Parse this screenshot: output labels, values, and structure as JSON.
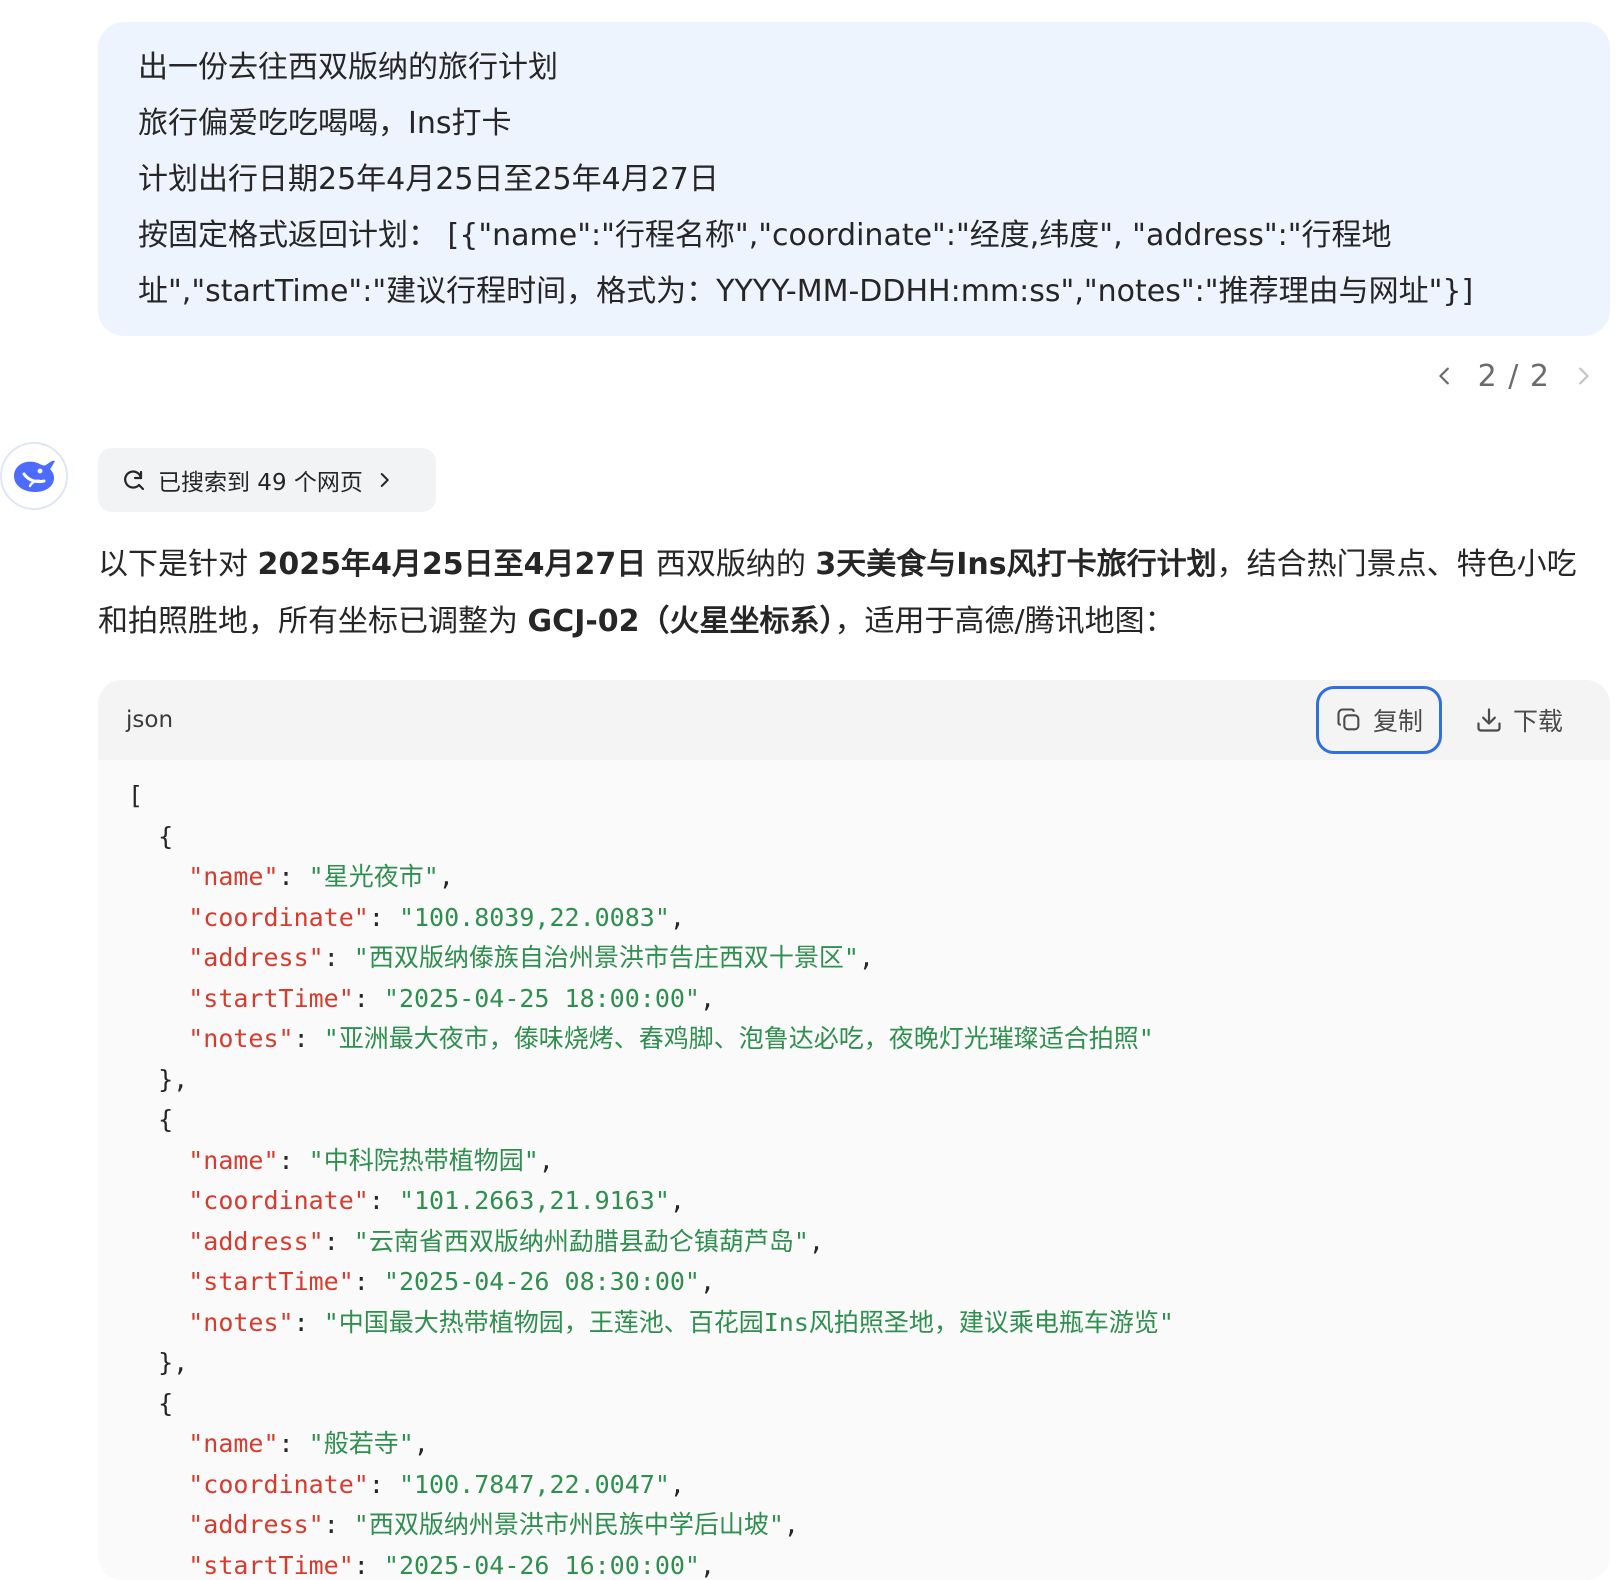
{
  "user_message": {
    "lines": [
      "出一份去往西双版纳的旅行计划",
      "旅行偏爱吃吃喝喝，Ins打卡",
      "计划出行日期25年4月25日至25年4月27日",
      "按固定格式返回计划：  [{\"name\":\"行程名称\",\"coordinate\":\"经度,纬度\", \"address\":\"行程地",
      "址\",\"startTime\":\"建议行程时间，格式为：YYYY-MM-DDHH:mm:ss\",\"notes\":\"推荐理由与网址\"}]"
    ]
  },
  "pager": {
    "text": "2 / 2"
  },
  "search_chip": {
    "label": "已搜索到 49 个网页"
  },
  "answer": {
    "p1": "以下是针对 ",
    "b1": "2025年4月25日至4月27日",
    "p2": " 西双版纳的 ",
    "b2": "3天美食与Ins风打卡旅行计划",
    "p3": "，结合热门景点、特色小吃和拍照胜地，所有坐标已调整为 ",
    "b3": "GCJ-02（火星坐标系）",
    "p4": "，适用于高德/腾讯地图："
  },
  "code_block": {
    "language": "json",
    "copy_label": "复制",
    "download_label": "下载",
    "open_bracket": "[",
    "keys": {
      "name": "\"name\"",
      "coordinate": "\"coordinate\"",
      "address": "\"address\"",
      "startTime": "\"startTime\"",
      "notes": "\"notes\""
    },
    "items": [
      {
        "name": "\"星光夜市\"",
        "coordinate": "\"100.8039,22.0083\"",
        "address": "\"西双版纳傣族自治州景洪市告庄西双十景区\"",
        "startTime": "\"2025-04-25 18:00:00\"",
        "notes": "\"亚洲最大夜市，傣味烧烤、舂鸡脚、泡鲁达必吃，夜晚灯光璀璨适合拍照\""
      },
      {
        "name": "\"中科院热带植物园\"",
        "coordinate": "\"101.2663,21.9163\"",
        "address": "\"云南省西双版纳州勐腊县勐仑镇葫芦岛\"",
        "startTime": "\"2025-04-26 08:30:00\"",
        "notes": "\"中国最大热带植物园，王莲池、百花园Ins风拍照圣地，建议乘电瓶车游览\""
      },
      {
        "name": "\"般若寺\"",
        "coordinate": "\"100.7847,22.0047\"",
        "address": "\"西双版纳州景洪市州民族中学后山坡\"",
        "startTime": "\"2025-04-26 16:00:00\""
      }
    ]
  }
}
